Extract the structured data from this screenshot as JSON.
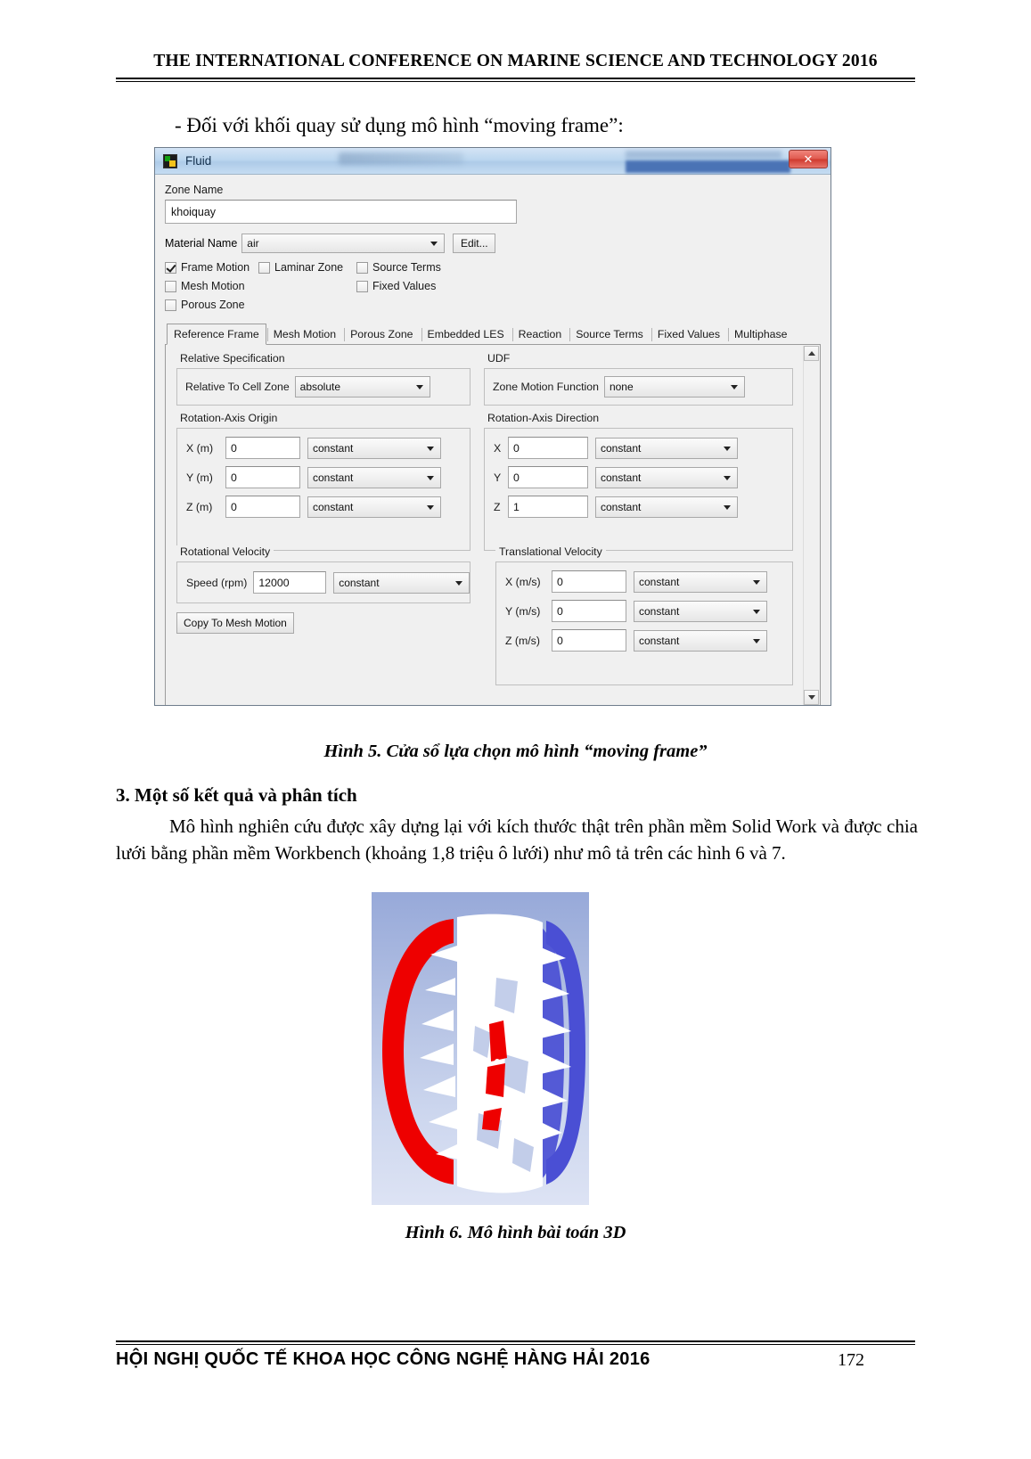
{
  "header": {
    "conference_title": "THE INTERNATIONAL CONFERENCE ON MARINE SCIENCE AND TECHNOLOGY 2016"
  },
  "intro_line": "- Đối với khối quay sử dụng mô hình “moving frame”:",
  "dialog": {
    "title": "Fluid",
    "close_label": "✕",
    "zone_name_label": "Zone Name",
    "zone_name_value": "khoiquay",
    "material_name_label": "Material Name",
    "material_name_value": "air",
    "edit_button": "Edit...",
    "checkboxes": [
      {
        "label": "Frame Motion",
        "checked": true
      },
      {
        "label": "Laminar Zone",
        "checked": false
      },
      {
        "label": "Source Terms",
        "checked": false
      },
      {
        "label": "Mesh Motion",
        "checked": false
      },
      {
        "label": "Fixed Values",
        "checked": false
      },
      {
        "label": "Porous Zone",
        "checked": false
      }
    ],
    "tabs": [
      {
        "label": "Reference Frame",
        "active": true
      },
      {
        "label": "Mesh Motion",
        "active": false
      },
      {
        "label": "Porous Zone",
        "active": false
      },
      {
        "label": "Embedded LES",
        "active": false
      },
      {
        "label": "Reaction",
        "active": false
      },
      {
        "label": "Source Terms",
        "active": false
      },
      {
        "label": "Fixed Values",
        "active": false
      },
      {
        "label": "Multiphase",
        "active": false
      }
    ],
    "relative_specification": {
      "group_title": "Relative Specification",
      "field_label": "Relative To Cell Zone",
      "value": "absolute"
    },
    "udf": {
      "group_title": "UDF",
      "field_label": "Zone Motion Function",
      "value": "none"
    },
    "rotation_axis_origin": {
      "group_title": "Rotation-Axis Origin",
      "rows": [
        {
          "label": "X (m)",
          "value": "0",
          "method": "constant"
        },
        {
          "label": "Y (m)",
          "value": "0",
          "method": "constant"
        },
        {
          "label": "Z (m)",
          "value": "0",
          "method": "constant"
        }
      ]
    },
    "rotation_axis_direction": {
      "group_title": "Rotation-Axis Direction",
      "rows": [
        {
          "label": "X",
          "value": "0",
          "method": "constant"
        },
        {
          "label": "Y",
          "value": "0",
          "method": "constant"
        },
        {
          "label": "Z",
          "value": "1",
          "method": "constant"
        }
      ]
    },
    "rotational_velocity": {
      "group_title": "Rotational Velocity",
      "rows": [
        {
          "label": "Speed (rpm)",
          "value": "12000",
          "method": "constant"
        }
      ],
      "copy_button": "Copy To Mesh Motion"
    },
    "translational_velocity": {
      "group_title": "Translational Velocity",
      "rows": [
        {
          "label": "X (m/s)",
          "value": "0",
          "method": "constant"
        },
        {
          "label": "Y (m/s)",
          "value": "0",
          "method": "constant"
        },
        {
          "label": "Z (m/s)",
          "value": "0",
          "method": "constant"
        }
      ]
    }
  },
  "figure5_caption": "Hình 5. Cửa sổ lựa chọn mô hình “moving frame”",
  "section3": {
    "heading": "3. Một số kết quả và phân tích",
    "paragraph": "Mô hình nghiên cứu được xây dựng lại với kích thước thật trên phần mềm Solid Work và được chia lưới bằng phần mềm Workbench (khoảng 1,8 triệu ô lưới) như mô tả trên các hình 6 và 7."
  },
  "figure6_caption": "Hình 6. Mô hình bài toán 3D",
  "figure6_colors": {
    "background_top": "#9fb0dc",
    "background_bottom": "#dde3f4",
    "inlet_red": "#ee0000",
    "outlet_blue": "#4a4fd4",
    "mesh_white": "#ffffff"
  },
  "footer": {
    "text": "HỘI NGHỊ QUỐC TẾ KHOA HỌC CÔNG NGHỆ HÀNG HẢI 2016",
    "page_number": "172"
  }
}
